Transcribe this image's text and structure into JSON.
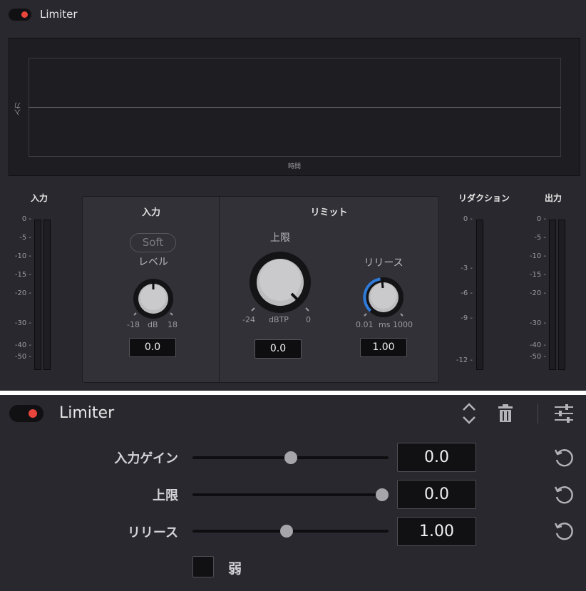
{
  "panel1": {
    "title": "Limiter",
    "graph": {
      "y_label": "入力",
      "x_label": "時間"
    },
    "input_meter": {
      "title": "入力",
      "ticks": [
        "0",
        "-5",
        "-10",
        "-15",
        "-20",
        "-30",
        "-40",
        "-50"
      ]
    },
    "input_section": {
      "title": "入力",
      "soft_label": "Soft",
      "knob_label": "レベル",
      "range_min": "-18",
      "unit": "dB",
      "range_max": "18",
      "value": "0.0"
    },
    "limit_section": {
      "title": "リミット",
      "ceiling": {
        "label": "上限",
        "range_min": "-24",
        "unit": "dBTP",
        "range_max": "0",
        "value": "0.0"
      },
      "release": {
        "label": "リリース",
        "range_min": "0.01",
        "unit": "ms",
        "range_max": "1000",
        "value": "1.00"
      }
    },
    "reduction_meter": {
      "title": "リダクション",
      "ticks": [
        "0",
        "-3",
        "-6",
        "-9",
        "-12"
      ]
    },
    "output_meter": {
      "title": "出力",
      "ticks": [
        "0",
        "-5",
        "-10",
        "-15",
        "-20",
        "-30",
        "-40",
        "-50"
      ]
    }
  },
  "panel2": {
    "title": "Limiter",
    "icons": {
      "reorder": "chevron-up-down-icon",
      "delete": "trash-icon",
      "settings": "sliders-icon",
      "reset": "reset-icon"
    },
    "rows": [
      {
        "label": "入力ゲイン",
        "value": "0.0",
        "slider_fraction": 0.5
      },
      {
        "label": "上限",
        "value": "0.0",
        "slider_fraction": 1.0
      },
      {
        "label": "リリース",
        "value": "1.00",
        "slider_fraction": 0.48
      }
    ],
    "checkbox": {
      "label": "弱",
      "checked": false
    }
  },
  "colors": {
    "background": "#28282e",
    "accent_red": "#e8453c",
    "knob_arc_blue": "#2f7bd9"
  }
}
